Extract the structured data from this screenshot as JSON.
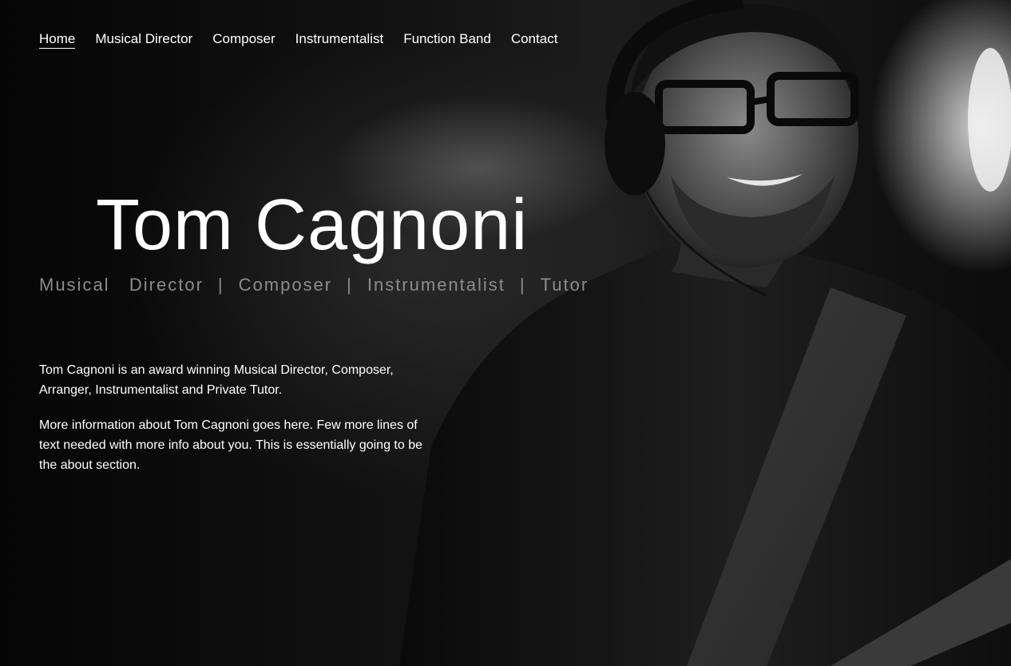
{
  "nav": {
    "items": [
      {
        "label": "Home",
        "active": true
      },
      {
        "label": "Musical Director",
        "active": false
      },
      {
        "label": "Composer",
        "active": false
      },
      {
        "label": "Instrumentalist",
        "active": false
      },
      {
        "label": "Function Band",
        "active": false
      },
      {
        "label": "Contact",
        "active": false
      }
    ]
  },
  "hero": {
    "title": "Tom Cagnoni",
    "roles": [
      "Musical   Director",
      "Composer",
      "Instrumentalist",
      "Tutor"
    ],
    "role_separator": "|"
  },
  "about": {
    "paragraphs": [
      "Tom Cagnoni is an award winning Musical Director, Composer, Arranger, Instrumentalist and Private Tutor.",
      "More information about Tom Cagnoni goes here. Few more lines of text needed with more info about you. This is essentially going to be the about section."
    ]
  },
  "colors": {
    "text": "#ffffff",
    "roles_text": "#8c8c8c",
    "background": "#000000"
  }
}
